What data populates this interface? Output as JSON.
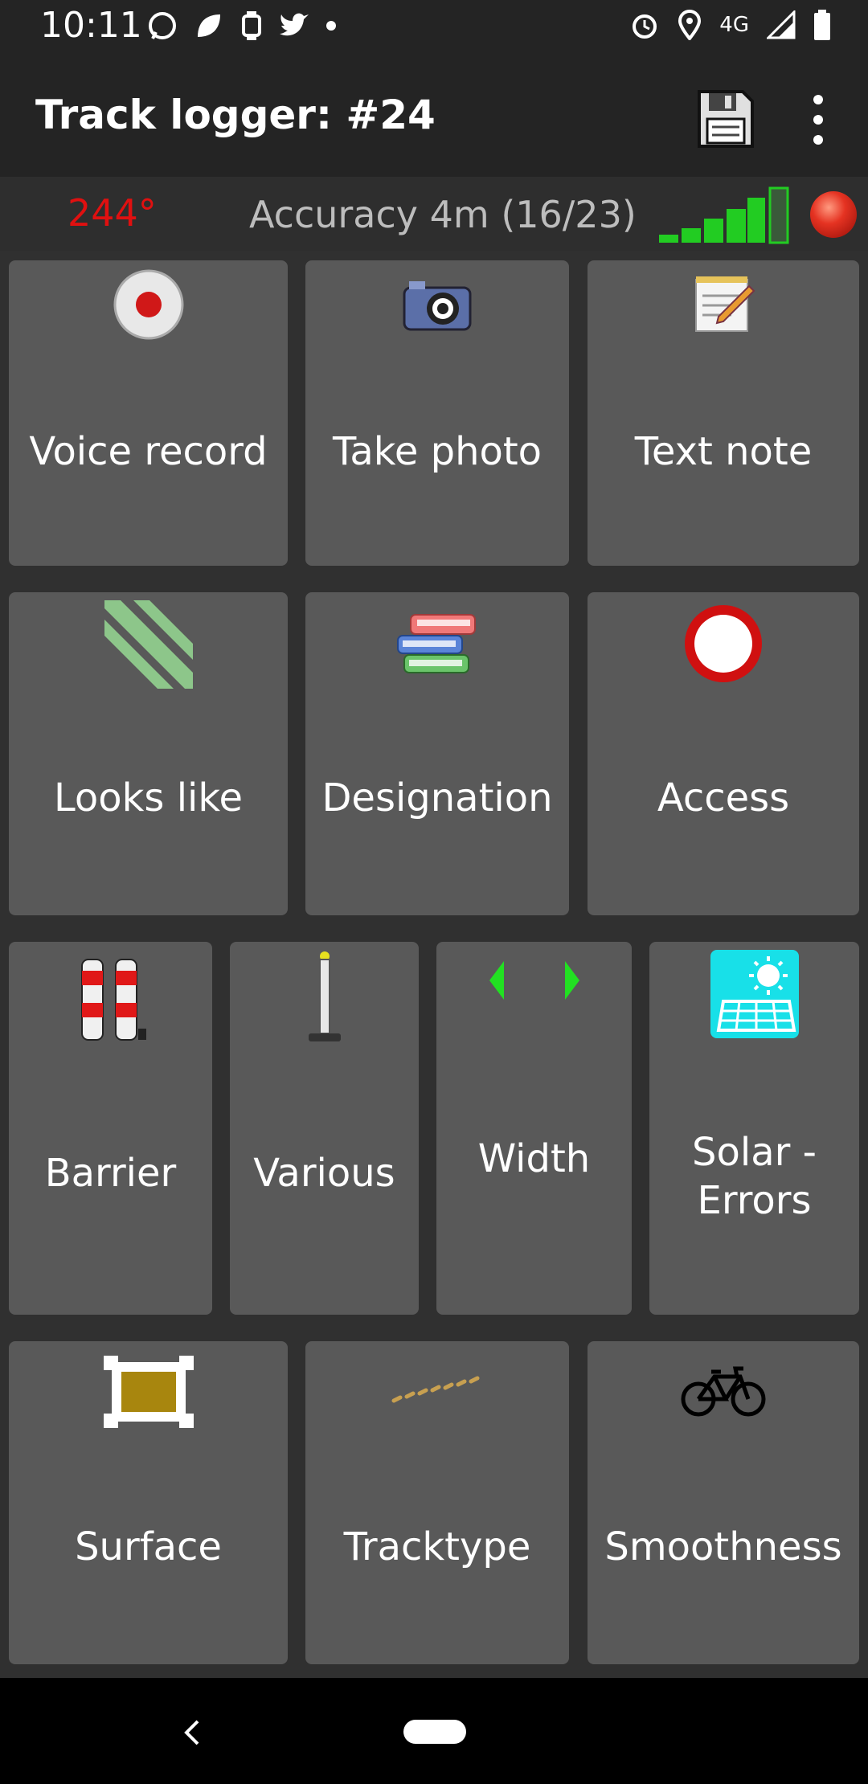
{
  "status_bar": {
    "time": "10:11",
    "network": "4G",
    "icons": [
      "whatsapp-icon",
      "leaf-icon",
      "watch-icon",
      "twitter-icon",
      "dot-icon",
      "alarm-icon",
      "location-icon",
      "signal-icon",
      "battery-icon"
    ]
  },
  "app_bar": {
    "title": "Track logger: #24",
    "actions": [
      "save-icon",
      "more-vert-icon"
    ]
  },
  "info": {
    "heading": "244°",
    "accuracy": "Accuracy 4m (16/23)",
    "colors": {
      "heading": "#e01010",
      "signal": "#22cc22",
      "rec": "#e53322"
    }
  },
  "tiles": [
    {
      "label": "Voice record",
      "icon": "record-icon"
    },
    {
      "label": "Take photo",
      "icon": "camera-icon"
    },
    {
      "label": "Text note",
      "icon": "notepad-icon"
    },
    {
      "label": "Looks like",
      "icon": "stripes-icon"
    },
    {
      "label": "Designation",
      "icon": "books-icon"
    },
    {
      "label": "Access",
      "icon": "no-entry-icon"
    },
    {
      "label": "Barrier",
      "icon": "bollards-icon"
    },
    {
      "label": "Various",
      "icon": "post-icon"
    },
    {
      "label": "Width",
      "icon": "width-arrows-icon"
    },
    {
      "label": "Solar -\nErrors",
      "icon": "solar-panel-icon"
    },
    {
      "label": "Surface",
      "icon": "surface-square-icon"
    },
    {
      "label": "Tracktype",
      "icon": "track-dashes-icon"
    },
    {
      "label": "Smoothness",
      "icon": "bicycle-icon"
    }
  ]
}
